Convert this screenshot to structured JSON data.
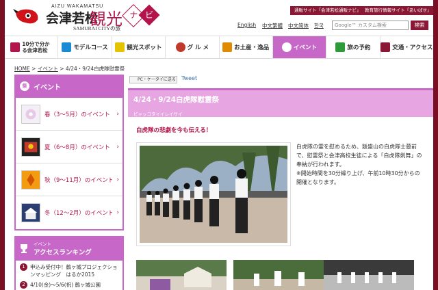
{
  "header": {
    "logo_en": "AIZU WAKAMATSU",
    "logo_jp": "会津若松",
    "logo_kanko": "観光",
    "logo_na": "ナ",
    "logo_bi": "ビ",
    "logo_sub": "SAMURAI CITYの旅",
    "top_buttons": [
      "通販サイト「会津若松通販ナビ」",
      "教育旅行情報サイト「あいばせ」"
    ],
    "languages": [
      "English",
      "中文繁體",
      "中文简体",
      "한국"
    ],
    "search_placeholder": "Google™ カスタム検索",
    "search_button": "検索"
  },
  "nav": [
    {
      "label": "10分で分かる会津若松",
      "icon": "book-icon",
      "color": "#b2144b"
    },
    {
      "label": "モデルコース",
      "icon": "arrow-icon",
      "color": "#1a8ad4"
    },
    {
      "label": "観光スポット",
      "icon": "spot-icon",
      "color": "#e6c300"
    },
    {
      "label": "グ ル メ",
      "icon": "bowl-icon",
      "color": "#c0392b"
    },
    {
      "label": "お土産・逸品",
      "icon": "gift-icon",
      "color": "#e08a00"
    },
    {
      "label": "イベント",
      "icon": "event-icon",
      "color": "#ffffff"
    },
    {
      "label": "旅の予約",
      "icon": "calendar-icon",
      "color": "#2e9b3a"
    },
    {
      "label": "交通・アクセス",
      "icon": "bus-icon",
      "color": "#8a1734"
    }
  ],
  "breadcrumb": {
    "home": "HOME",
    "sep": ">",
    "event": "イベント",
    "current": "4/24・9/24白虎隊慰霊祭"
  },
  "sidebar": {
    "badge": "祭",
    "title": "イベント",
    "seasons": [
      {
        "label": "春（3～5月）のイベント"
      },
      {
        "label": "夏（6～8月）のイベント"
      },
      {
        "label": "秋（9～11月）のイベント"
      },
      {
        "label": "冬（12～2月）のイベント"
      }
    ],
    "ranking_small": "イベント",
    "ranking_title": "アクセスランキング",
    "ranking": [
      {
        "num": "1",
        "text": "申込み受付中！鶴ヶ城プロジェクションマッピング　はるか2015"
      },
      {
        "num": "2",
        "text": "4/10(金)～5/6(祝) 鶴ヶ城公園"
      }
    ]
  },
  "main": {
    "share_label": "PC・ケータイに送る",
    "tweet_label": "Tweet",
    "title": "4/24・9/24白虎隊慰霊祭",
    "kana": "ビャッコタイイレイサイ",
    "lead": "白虎隊の悲劇を今も伝える！",
    "description": [
      "白虎隊の霊を慰めるため、飯盛山の白虎隊士墓前で、慰霊祭と会津高校生徒による「白虎隊剣舞」の奉納が行われます。",
      "※開始時間を30分繰り上げ、午前10時30分からの開催となります。"
    ]
  }
}
